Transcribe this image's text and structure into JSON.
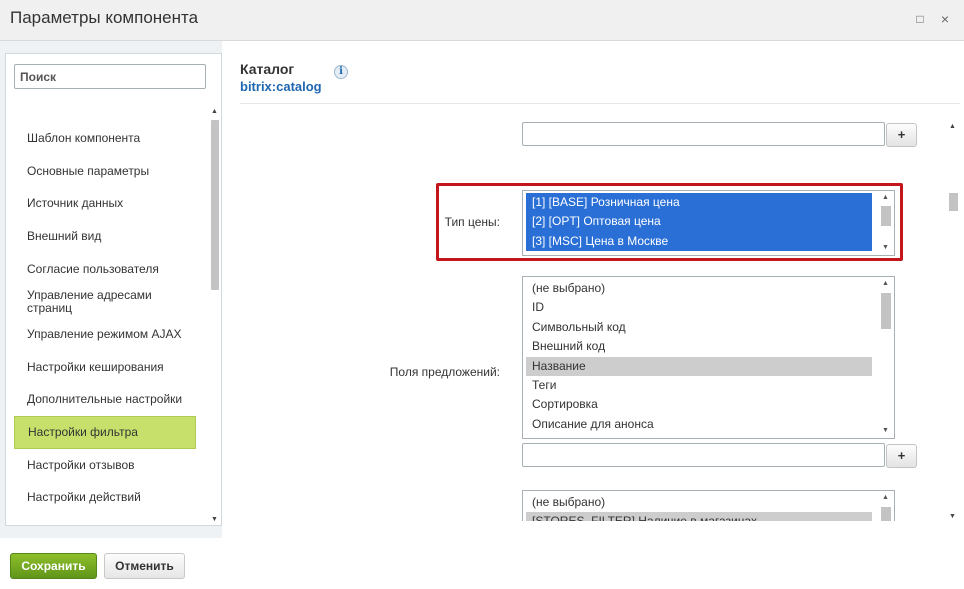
{
  "window": {
    "title": "Параметры компонента",
    "maximize_icon": "□",
    "close_icon": "×"
  },
  "sidebar": {
    "search_placeholder": "Поиск",
    "items": [
      {
        "label": "Шаблон компонента"
      },
      {
        "label": "Основные параметры"
      },
      {
        "label": "Источник данных"
      },
      {
        "label": "Внешний вид"
      },
      {
        "label": "Согласие пользователя"
      },
      {
        "label": "Управление адресами страниц"
      },
      {
        "label": "Управление режимом AJAX"
      },
      {
        "label": "Настройки кеширования"
      },
      {
        "label": "Дополнительные настройки"
      },
      {
        "label": "Настройки фильтра",
        "active": true
      },
      {
        "label": "Настройки отзывов"
      },
      {
        "label": "Настройки действий"
      }
    ]
  },
  "header": {
    "title": "Каталог",
    "subtitle": "bitrix:catalog",
    "info_icon": "i"
  },
  "fields": {
    "plus_label": "+",
    "price_type": {
      "label": "Тип цены:",
      "options": [
        {
          "text": "[1] [BASE] Розничная цена",
          "selected": true
        },
        {
          "text": "[2] [OPT] Оптовая цена",
          "selected": true
        },
        {
          "text": "[3] [MSC] Цена в Москве",
          "selected": true
        }
      ]
    },
    "offer_fields": {
      "label": "Поля предложений:",
      "options": [
        {
          "text": "(не выбрано)"
        },
        {
          "text": "ID"
        },
        {
          "text": "Символьный код"
        },
        {
          "text": "Внешний код"
        },
        {
          "text": "Название",
          "selected": true
        },
        {
          "text": "Теги"
        },
        {
          "text": "Сортировка"
        },
        {
          "text": "Описание для анонса"
        }
      ]
    },
    "stores": {
      "options": [
        {
          "text": "(не выбрано)"
        },
        {
          "text": "[STORES_FILTER] Наличие в магазинах",
          "selected": true
        }
      ]
    }
  },
  "footer": {
    "save_label": "Сохранить",
    "cancel_label": "Отменить"
  },
  "colors": {
    "selection_blue": "#2a6fd6",
    "highlight_red": "#c3161c",
    "active_nav_green": "#c6e06b",
    "save_green": "#6fa31f"
  }
}
